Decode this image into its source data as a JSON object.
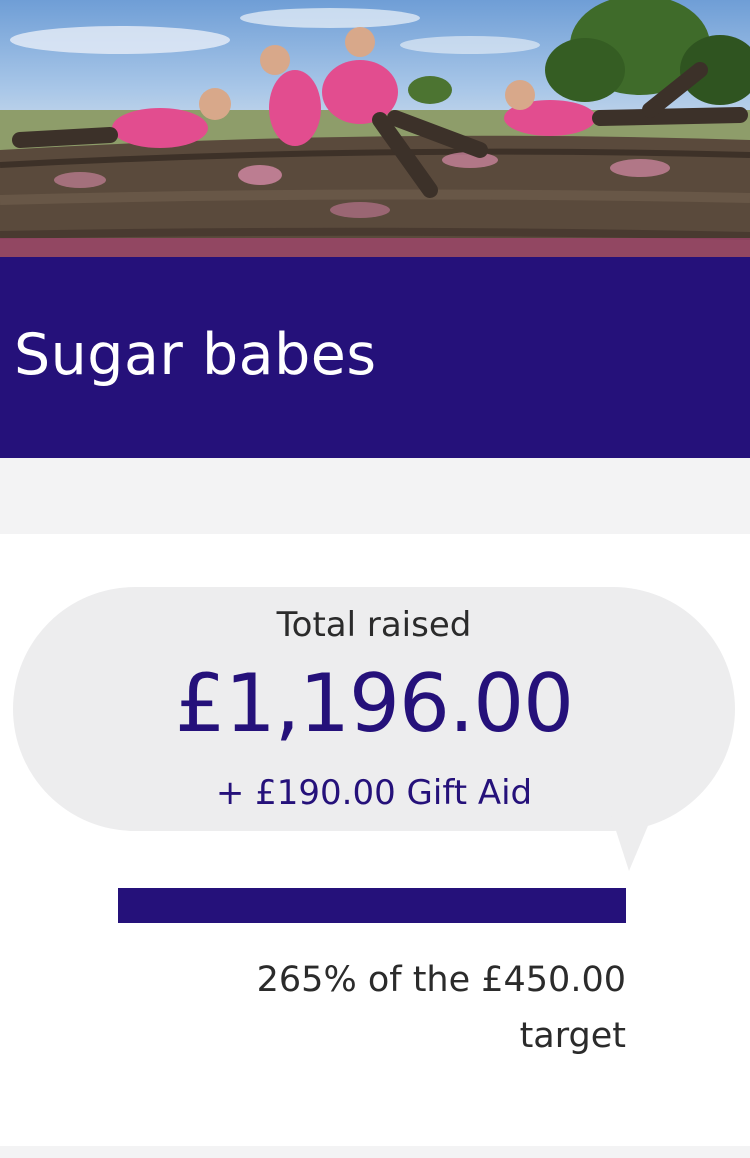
{
  "page": {
    "title": "Sugar babes",
    "brand_color": "#25117a",
    "accent_color": "#e24d8f"
  },
  "hero": {
    "image_name": "mud-obstacle-photo"
  },
  "fundraising": {
    "total_label": "Total raised",
    "total_amount": "£1,196.00",
    "gift_aid": "+ £190.00 Gift Aid",
    "progress_fraction": 1.0,
    "target_line1": "265% of the £450.00",
    "target_line2": "target"
  }
}
